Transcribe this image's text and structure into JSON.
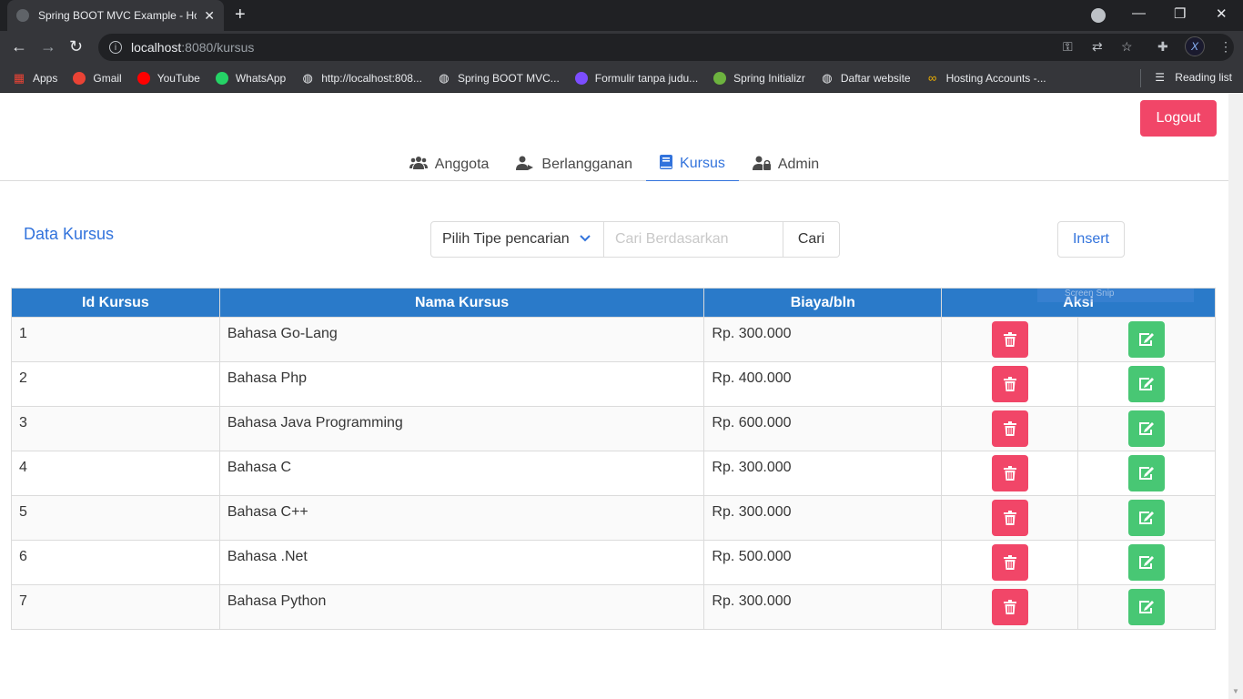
{
  "browser": {
    "tab_title": "Spring BOOT MVC Example - Hom",
    "url_host": "localhost",
    "url_path": ":8080/kursus",
    "bookmarks": [
      {
        "label": "Apps",
        "icon": "apps-grid-icon",
        "color": "#ea4335"
      },
      {
        "label": "Gmail",
        "icon": "gmail-icon",
        "color": "#ea4335"
      },
      {
        "label": "YouTube",
        "icon": "youtube-icon",
        "color": "#ff0000"
      },
      {
        "label": "WhatsApp",
        "icon": "whatsapp-icon",
        "color": "#25d366"
      },
      {
        "label": "http://localhost:808...",
        "icon": "globe-icon",
        "color": "#e8eaed"
      },
      {
        "label": "Spring BOOT MVC...",
        "icon": "globe-icon",
        "color": "#e8eaed"
      },
      {
        "label": "Formulir tanpa judu...",
        "icon": "forms-icon",
        "color": "#7c4dff"
      },
      {
        "label": "Spring Initializr",
        "icon": "spring-icon",
        "color": "#6db33f"
      },
      {
        "label": "Daftar website",
        "icon": "globe-icon",
        "color": "#e8eaed"
      },
      {
        "label": "Hosting Accounts -...",
        "icon": "infinity-icon",
        "color": "#f4b400"
      }
    ],
    "reading_list": "Reading list"
  },
  "header": {
    "logout_label": "Logout"
  },
  "tabs": [
    {
      "label": "Anggota",
      "icon": "users-icon",
      "active": false
    },
    {
      "label": "Berlangganan",
      "icon": "user-arrow-icon",
      "active": false
    },
    {
      "label": "Kursus",
      "icon": "book-icon",
      "active": true
    },
    {
      "label": "Admin",
      "icon": "user-lock-icon",
      "active": false
    }
  ],
  "main": {
    "title": "Data Kursus",
    "search": {
      "type_select": "Pilih Tipe pencarian",
      "placeholder": "Cari Berdasarkan",
      "button": "Cari"
    },
    "insert_label": "Insert",
    "snip_overlay": "Screen Snip"
  },
  "table": {
    "headers": [
      "Id Kursus",
      "Nama Kursus",
      "Biaya/bln",
      "Aksi"
    ],
    "rows": [
      {
        "id": "1",
        "nama": "Bahasa Go-Lang",
        "biaya": "Rp. 300.000"
      },
      {
        "id": "2",
        "nama": "Bahasa Php",
        "biaya": "Rp. 400.000"
      },
      {
        "id": "3",
        "nama": "Bahasa Java Programming",
        "biaya": "Rp. 600.000"
      },
      {
        "id": "4",
        "nama": "Bahasa C",
        "biaya": "Rp. 300.000"
      },
      {
        "id": "5",
        "nama": "Bahasa C++",
        "biaya": "Rp. 300.000"
      },
      {
        "id": "6",
        "nama": "Bahasa .Net",
        "biaya": "Rp. 500.000"
      },
      {
        "id": "7",
        "nama": "Bahasa Python",
        "biaya": "Rp. 300.000"
      }
    ]
  },
  "colors": {
    "primary": "#3273dc",
    "danger": "#f14668",
    "success": "#48c774",
    "table_header": "#2a7ac9"
  }
}
